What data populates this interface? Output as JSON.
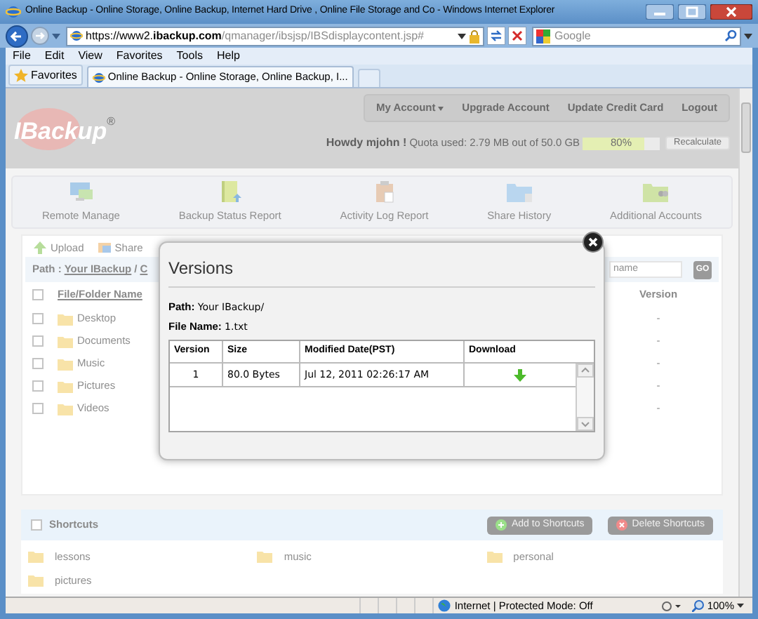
{
  "window": {
    "title": "Online Backup - Online Storage, Online Backup, Internet Hard Drive , Online File Storage and Co - Windows Internet Explorer"
  },
  "address_bar": {
    "url_prefix": "https://www2.",
    "url_domain": "ibackup.com",
    "url_path": "/qmanager/ibsjsp/IBSdisplaycontent.jsp#",
    "search_placeholder": "Google"
  },
  "menu": [
    "File",
    "Edit",
    "View",
    "Favorites",
    "Tools",
    "Help"
  ],
  "favorites_bar": {
    "favorites": "Favorites",
    "tabs": [
      {
        "label": "Online Backup - Online Storage, Online Backup, I...",
        "selected": true
      }
    ]
  },
  "page": {
    "logo": "IBackup",
    "logo_mark": "®",
    "account_nav": [
      {
        "label": "My Account",
        "dropdown": true
      },
      {
        "label": "Upgrade Account",
        "dropdown": false
      },
      {
        "label": "Update Credit Card",
        "dropdown": false
      },
      {
        "label": "Logout",
        "dropdown": false
      }
    ],
    "greeting": "Howdy mjohn !",
    "quota_text": "Quota used: 2.79 MB out of 50.0 GB",
    "quota": {
      "level": 0.8,
      "reading": "80%"
    },
    "recalculate": "Recalculate",
    "tools": [
      {
        "label": "Remote Manage",
        "kind": "monitor"
      },
      {
        "label": "Backup Status Report",
        "kind": "report"
      },
      {
        "label": "Activity Log Report",
        "kind": "log"
      },
      {
        "label": "Share History",
        "kind": "folder"
      },
      {
        "label": "Additional Accounts",
        "kind": "users"
      }
    ],
    "actions": [
      {
        "label": "Upload",
        "kind": "upload"
      },
      {
        "label": "Share",
        "kind": "share"
      }
    ],
    "path": {
      "label": "Path :",
      "link": "Your IBackup",
      "separator": "/",
      "cut": "C"
    },
    "search": {
      "placeholder": "name",
      "button": "GO"
    },
    "file_table": {
      "select_all": false,
      "columns": [
        "File/Folder Name",
        "Version"
      ],
      "rows": [
        {
          "name": "Desktop",
          "version": "-",
          "checked": false
        },
        {
          "name": "Documents",
          "version": "-",
          "checked": false
        },
        {
          "name": "Music",
          "version": "-",
          "checked": false
        },
        {
          "name": "Pictures",
          "version": "-",
          "checked": false
        },
        {
          "name": "Videos",
          "version": "-",
          "checked": false
        }
      ]
    },
    "shortcuts": {
      "title": "Shortcuts",
      "checked": false,
      "buttons": [
        {
          "label": "Add to Shortcuts",
          "kind": "add"
        },
        {
          "label": "Delete Shortcuts",
          "kind": "delete"
        }
      ],
      "items": [
        "lessons",
        "music",
        "personal",
        "pictures"
      ]
    }
  },
  "dialog": {
    "title": "Versions",
    "path_label": "Path:",
    "path": "Your IBackup/",
    "file_label": "File Name:",
    "file": "1.txt",
    "columns": [
      "Version",
      "Size",
      "Modified Date(PST)",
      "Download"
    ],
    "rows": [
      {
        "version": "1",
        "size": "80.0 Bytes",
        "modified": "Jul 12, 2011 02:26:17 AM"
      }
    ]
  },
  "status_bar": {
    "zone": "Internet | Protected Mode: Off",
    "zoom": "100%"
  }
}
